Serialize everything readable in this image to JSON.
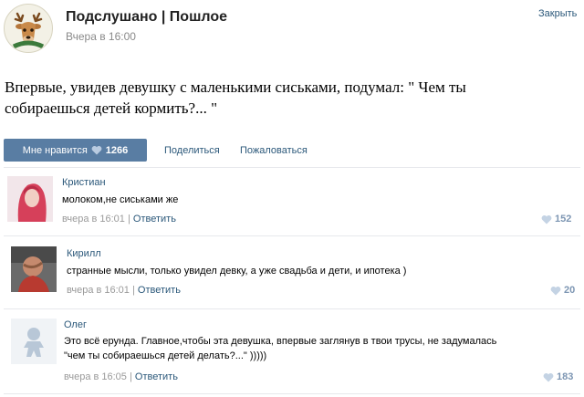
{
  "post": {
    "group_name": "Подслушано | Пошлое",
    "time": "Вчера в 16:00",
    "close_label": "Закрыть",
    "text_line1": "Впервые, увидев девушку с маленькими сиськами, подумал: \" Чем ты",
    "text_line2": "собираешься детей кормить?... \"",
    "like_label": "Мне нравится",
    "like_count": "1266",
    "share_label": "Поделиться",
    "report_label": "Пожаловаться"
  },
  "comments": [
    {
      "author": "Кристиан",
      "text": "молоком,не сиськами же",
      "time": "вчера в 16:01",
      "reply_label": "Ответить",
      "likes": "152"
    },
    {
      "author": "Кирилл",
      "text": "странные мысли, только увидел девку, а уже свадьба и дети, и ипотека )",
      "time": "вчера в 16:01",
      "reply_label": "Ответить",
      "likes": "20"
    },
    {
      "author": "Олег",
      "text_line1": "Это всё ерунда. Главное,чтобы эта девушка, впервые заглянув в твои трусы, не задумалась",
      "text_line2": "\"чем ты собираешься детей делать?...\" )))))",
      "time": "вчера в 16:05",
      "reply_label": "Ответить",
      "likes": "183"
    }
  ],
  "meta_separator": "|",
  "colors": {
    "accent": "#597da3",
    "link": "#2b587a",
    "like_count": "#7d96b3"
  }
}
